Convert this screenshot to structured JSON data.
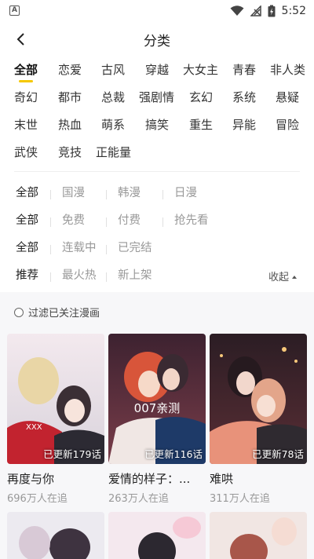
{
  "status": {
    "app_icon_letter": "A",
    "time": "5:52"
  },
  "header": {
    "title": "分类"
  },
  "genres": {
    "row1": [
      "全部",
      "恋爱",
      "古风",
      "穿越",
      "大女主",
      "青春",
      "非人类"
    ],
    "row2": [
      "奇幻",
      "都市",
      "总裁",
      "强剧情",
      "玄幻",
      "系统",
      "悬疑"
    ],
    "row3": [
      "末世",
      "热血",
      "萌系",
      "搞笑",
      "重生",
      "异能",
      "冒险"
    ],
    "row4": [
      "武侠",
      "竞技",
      "正能量"
    ]
  },
  "filters": {
    "region": [
      "全部",
      "国漫",
      "韩漫",
      "日漫"
    ],
    "price": [
      "全部",
      "免费",
      "付费",
      "抢先看"
    ],
    "status": [
      "全部",
      "连载中",
      "已完结"
    ],
    "sort": [
      "推荐",
      "最火热",
      "新上架"
    ],
    "collapse_label": "收起"
  },
  "follow_filter_label": "过滤已关注漫画",
  "cards": [
    {
      "title": "再度与你",
      "followers": "696万人在追",
      "badge": "已更新179话",
      "watermark": ""
    },
    {
      "title": "爱情的样子：...",
      "followers": "263万人在追",
      "badge": "已更新116话",
      "watermark": "007亲测"
    },
    {
      "title": "难哄",
      "followers": "311万人在追",
      "badge": "已更新78话",
      "watermark": ""
    }
  ],
  "colors": {
    "accent": "#f5c800",
    "muted_text": "#999999",
    "list_background": "#f7f7f9"
  }
}
